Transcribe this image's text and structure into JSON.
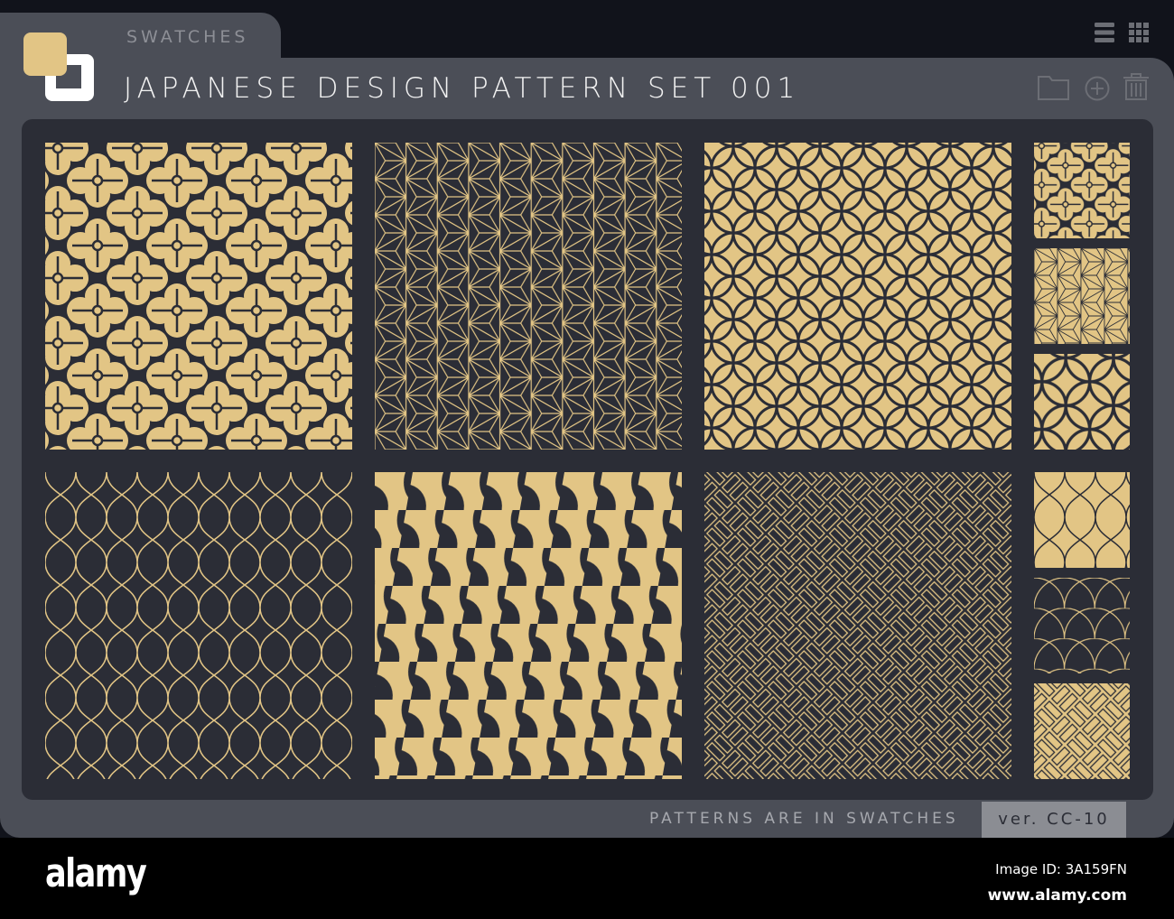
{
  "header": {
    "tab_label": "SWATCHES",
    "title": "JAPANESE DESIGN PATTERN SET 001"
  },
  "toolbar": {
    "icons": [
      "list-view-icon",
      "grid-view-icon",
      "folder-icon",
      "add-circle-icon",
      "trash-icon"
    ]
  },
  "swatches": [
    {
      "name": "hanabishi-flower"
    },
    {
      "name": "asanoha"
    },
    {
      "name": "shippo"
    },
    {
      "name": "tatewaku-net"
    },
    {
      "name": "fan-wave"
    },
    {
      "name": "ajiro-weave"
    }
  ],
  "footer": {
    "note": "PATTERNS ARE IN SWATCHES",
    "version": "ver. CC-10"
  },
  "watermark": {
    "logo": "alamy",
    "image_id": "Image ID: 3A159FN",
    "url": "www.alamy.com"
  },
  "colors": {
    "gold": "#e2c585",
    "dark": "#2b2d36",
    "panel": "#4b4e57"
  }
}
